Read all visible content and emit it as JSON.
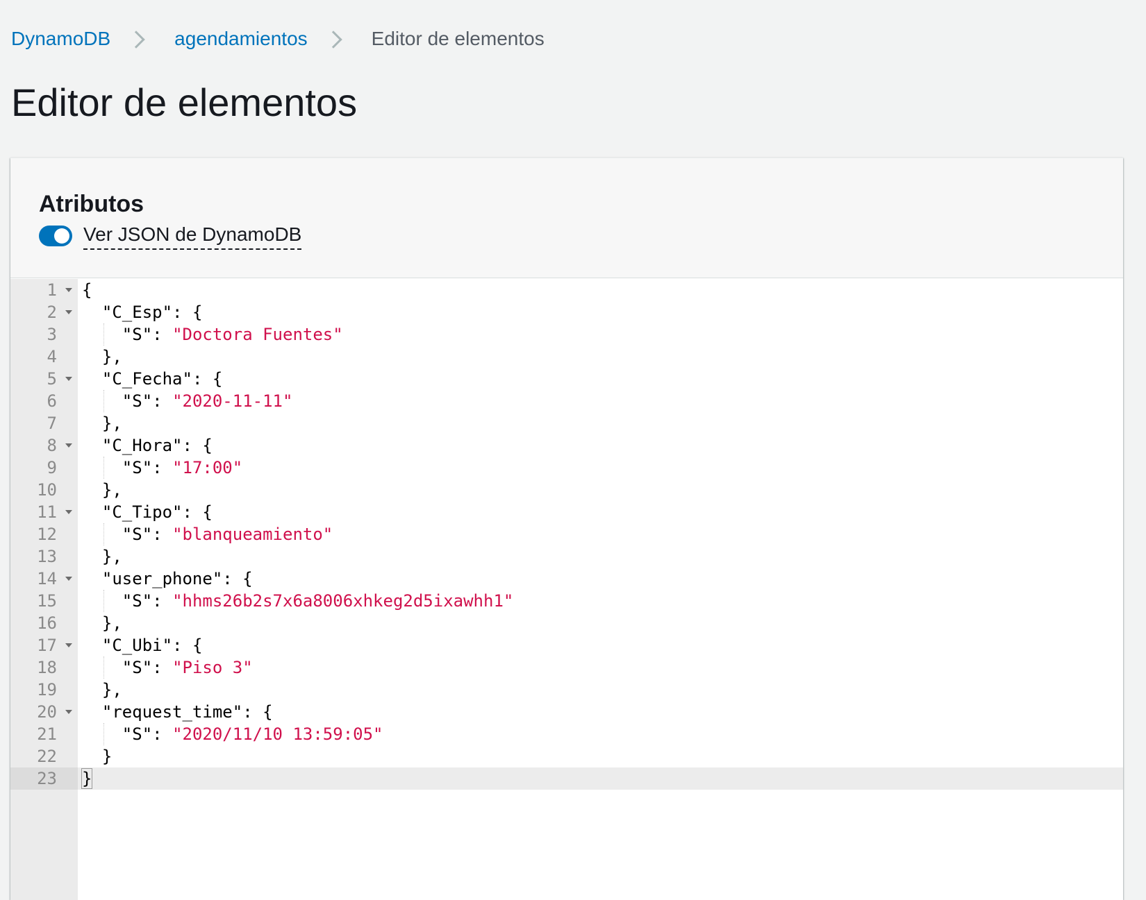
{
  "breadcrumb": {
    "items": [
      "DynamoDB",
      "agendamientos"
    ],
    "current": "Editor de elementos"
  },
  "page": {
    "title": "Editor de elementos"
  },
  "attributes": {
    "title": "Atributos",
    "toggle_label": "Ver JSON de DynamoDB",
    "toggle_on": true
  },
  "editor": {
    "lines": [
      {
        "n": "1",
        "fold": true,
        "indent": 0,
        "key": "",
        "punct": "{",
        "value": ""
      },
      {
        "n": "2",
        "fold": true,
        "indent": 1,
        "key": "\"C_Esp\"",
        "punct": ": {",
        "value": ""
      },
      {
        "n": "3",
        "fold": false,
        "indent": 2,
        "key": "\"S\"",
        "punct": ": ",
        "value": "\"Doctora Fuentes\""
      },
      {
        "n": "4",
        "fold": false,
        "indent": 1,
        "key": "",
        "punct": "},",
        "value": ""
      },
      {
        "n": "5",
        "fold": true,
        "indent": 1,
        "key": "\"C_Fecha\"",
        "punct": ": {",
        "value": ""
      },
      {
        "n": "6",
        "fold": false,
        "indent": 2,
        "key": "\"S\"",
        "punct": ": ",
        "value": "\"2020-11-11\""
      },
      {
        "n": "7",
        "fold": false,
        "indent": 1,
        "key": "",
        "punct": "},",
        "value": ""
      },
      {
        "n": "8",
        "fold": true,
        "indent": 1,
        "key": "\"C_Hora\"",
        "punct": ": {",
        "value": ""
      },
      {
        "n": "9",
        "fold": false,
        "indent": 2,
        "key": "\"S\"",
        "punct": ": ",
        "value": "\"17:00\""
      },
      {
        "n": "10",
        "fold": false,
        "indent": 1,
        "key": "",
        "punct": "},",
        "value": ""
      },
      {
        "n": "11",
        "fold": true,
        "indent": 1,
        "key": "\"C_Tipo\"",
        "punct": ": {",
        "value": ""
      },
      {
        "n": "12",
        "fold": false,
        "indent": 2,
        "key": "\"S\"",
        "punct": ": ",
        "value": "\"blanqueamiento\""
      },
      {
        "n": "13",
        "fold": false,
        "indent": 1,
        "key": "",
        "punct": "},",
        "value": ""
      },
      {
        "n": "14",
        "fold": true,
        "indent": 1,
        "key": "\"user_phone\"",
        "punct": ": {",
        "value": ""
      },
      {
        "n": "15",
        "fold": false,
        "indent": 2,
        "key": "\"S\"",
        "punct": ": ",
        "value": "\"hhms26b2s7x6a8006xhkeg2d5ixawhh1\""
      },
      {
        "n": "16",
        "fold": false,
        "indent": 1,
        "key": "",
        "punct": "},",
        "value": ""
      },
      {
        "n": "17",
        "fold": true,
        "indent": 1,
        "key": "\"C_Ubi\"",
        "punct": ": {",
        "value": ""
      },
      {
        "n": "18",
        "fold": false,
        "indent": 2,
        "key": "\"S\"",
        "punct": ": ",
        "value": "\"Piso 3\""
      },
      {
        "n": "19",
        "fold": false,
        "indent": 1,
        "key": "",
        "punct": "},",
        "value": ""
      },
      {
        "n": "20",
        "fold": true,
        "indent": 1,
        "key": "\"request_time\"",
        "punct": ": {",
        "value": ""
      },
      {
        "n": "21",
        "fold": false,
        "indent": 2,
        "key": "\"S\"",
        "punct": ": ",
        "value": "\"2020/11/10 13:59:05\""
      },
      {
        "n": "22",
        "fold": false,
        "indent": 1,
        "key": "",
        "punct": "}",
        "value": ""
      },
      {
        "n": "23",
        "fold": false,
        "indent": 0,
        "key": "",
        "punct": "}",
        "value": "",
        "active": true
      }
    ]
  },
  "colors": {
    "link": "#0073bb",
    "toggle": "#0073bb",
    "string_value": "#d0104c"
  }
}
